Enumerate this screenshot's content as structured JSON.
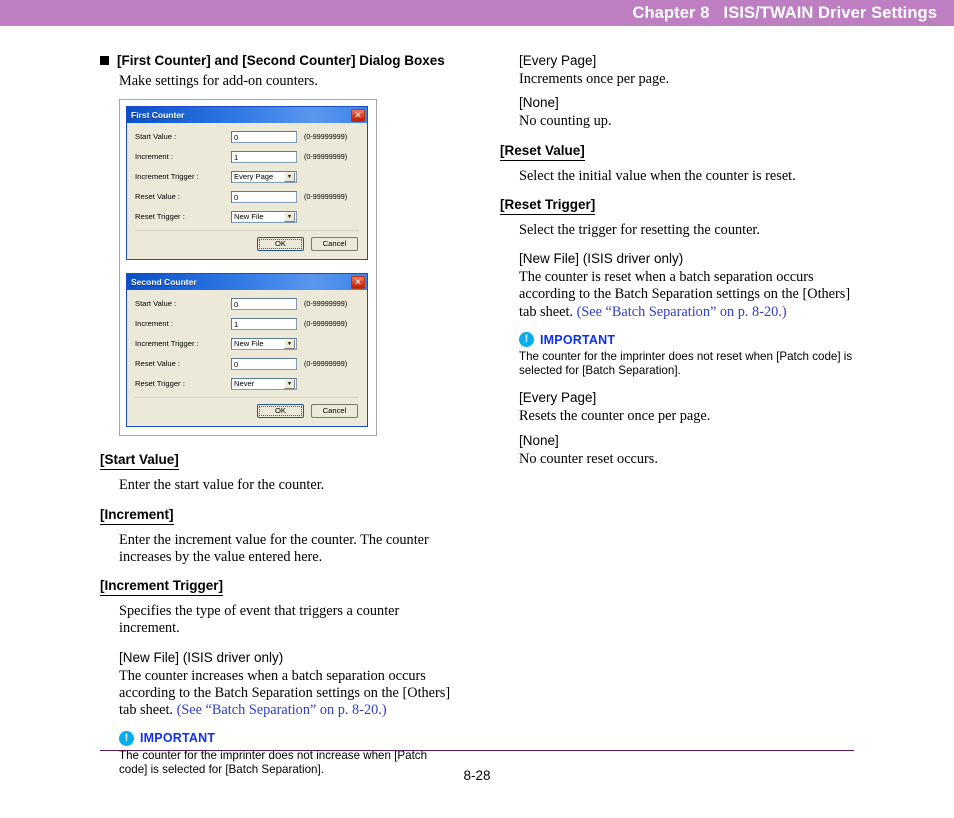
{
  "header": {
    "chapter": "Chapter 8",
    "title": "ISIS/TWAIN Driver Settings",
    "full": "Chapter 8   ISIS/TWAIN Driver Settings",
    "background_color": "#bd7fc2"
  },
  "footer": {
    "page_number": "8-28",
    "rule_color": "#5b1a5e"
  },
  "left_column": {
    "section_heading": "[First Counter] and [Second Counter] Dialog Boxes",
    "intro": "Make settings for add-on counters.",
    "dialogs": [
      {
        "title": "First Counter",
        "close_label": "✕",
        "fields": [
          {
            "label": "Start Value :",
            "mnemonic": "S",
            "type": "text",
            "value": "0",
            "range": "(0-99999999)"
          },
          {
            "label": "Increment :",
            "mnemonic": "I",
            "type": "text",
            "value": "1",
            "range": "(0-99999999)"
          },
          {
            "label": "Increment Trigger :",
            "mnemonic": "n",
            "type": "select",
            "value": "Every Page",
            "range": ""
          },
          {
            "label": "Reset Value :",
            "mnemonic": "R",
            "type": "text",
            "value": "0",
            "range": "(0-99999999)"
          },
          {
            "label": "Reset Trigger :",
            "mnemonic": "T",
            "type": "select",
            "value": "New File",
            "range": ""
          }
        ],
        "ok_label": "OK",
        "cancel_label": "Cancel"
      },
      {
        "title": "Second Counter",
        "close_label": "✕",
        "fields": [
          {
            "label": "Start Value :",
            "mnemonic": "S",
            "type": "text",
            "value": "0",
            "range": "(0-99999999)"
          },
          {
            "label": "Increment :",
            "mnemonic": "I",
            "type": "text",
            "value": "1",
            "range": "(0-99999999)"
          },
          {
            "label": "Increment Trigger :",
            "mnemonic": "n",
            "type": "select",
            "value": "New File",
            "range": ""
          },
          {
            "label": "Reset Value :",
            "mnemonic": "R",
            "type": "text",
            "value": "0",
            "range": "(0-99999999)"
          },
          {
            "label": "Reset Trigger :",
            "mnemonic": "T",
            "type": "select",
            "value": "Never",
            "range": ""
          }
        ],
        "ok_label": "OK",
        "cancel_label": "Cancel"
      }
    ],
    "terms": [
      {
        "term": "[Start Value]",
        "body": "Enter the start value for the counter."
      },
      {
        "term": "[Increment]",
        "body": "Enter the increment value for the counter. The counter increases by the value entered here."
      },
      {
        "term": "[Increment Trigger]",
        "body": "Specifies the type of event that triggers a counter increment."
      }
    ],
    "new_file_option": "[New File] (ISIS driver only)",
    "new_file_body_1": "The counter increases when a batch separation occurs according to the Batch Separation settings on the [Others] tab sheet. ",
    "new_file_xref": "(See “Batch Separation” on p. 8-20.)",
    "important": {
      "icon": "!",
      "label": "IMPORTANT",
      "body": "The counter for the imprinter does not increase when [Patch code] is selected for [Batch Separation]."
    }
  },
  "right_column": {
    "every_page_option": "[Every Page]",
    "every_page_body": "Increments once per page.",
    "none_option": "[None]",
    "none_body": "No counting up.",
    "reset_value_term": "[Reset Value]",
    "reset_value_body": "Select the initial value when the counter is reset.",
    "reset_trigger_term": "[Reset Trigger]",
    "reset_trigger_body": "Select the trigger for resetting the counter.",
    "new_file_option": "[New File] (ISIS driver only)",
    "new_file_body_1": "The counter is reset when a batch separation occurs according to the Batch Separation settings on the [Others] tab sheet. ",
    "new_file_xref": "(See “Batch Separation” on p. 8-20.)",
    "important": {
      "icon": "!",
      "label": "IMPORTANT",
      "body": "The counter for the imprinter does not reset when [Patch code] is selected for [Batch Separation]."
    },
    "reset_every_page_option": "[Every Page]",
    "reset_every_page_body": "Resets the counter once per page.",
    "reset_none_option": "[None]",
    "reset_none_body": "No counter reset occurs."
  },
  "colors": {
    "xref_blue": "#2f3fc4",
    "important_blue": "#0d2ff0",
    "important_icon_cyan": "#00aeef",
    "dialog_titlebar_blue": "#0a50c8",
    "dialog_face": "#ece9d8"
  }
}
